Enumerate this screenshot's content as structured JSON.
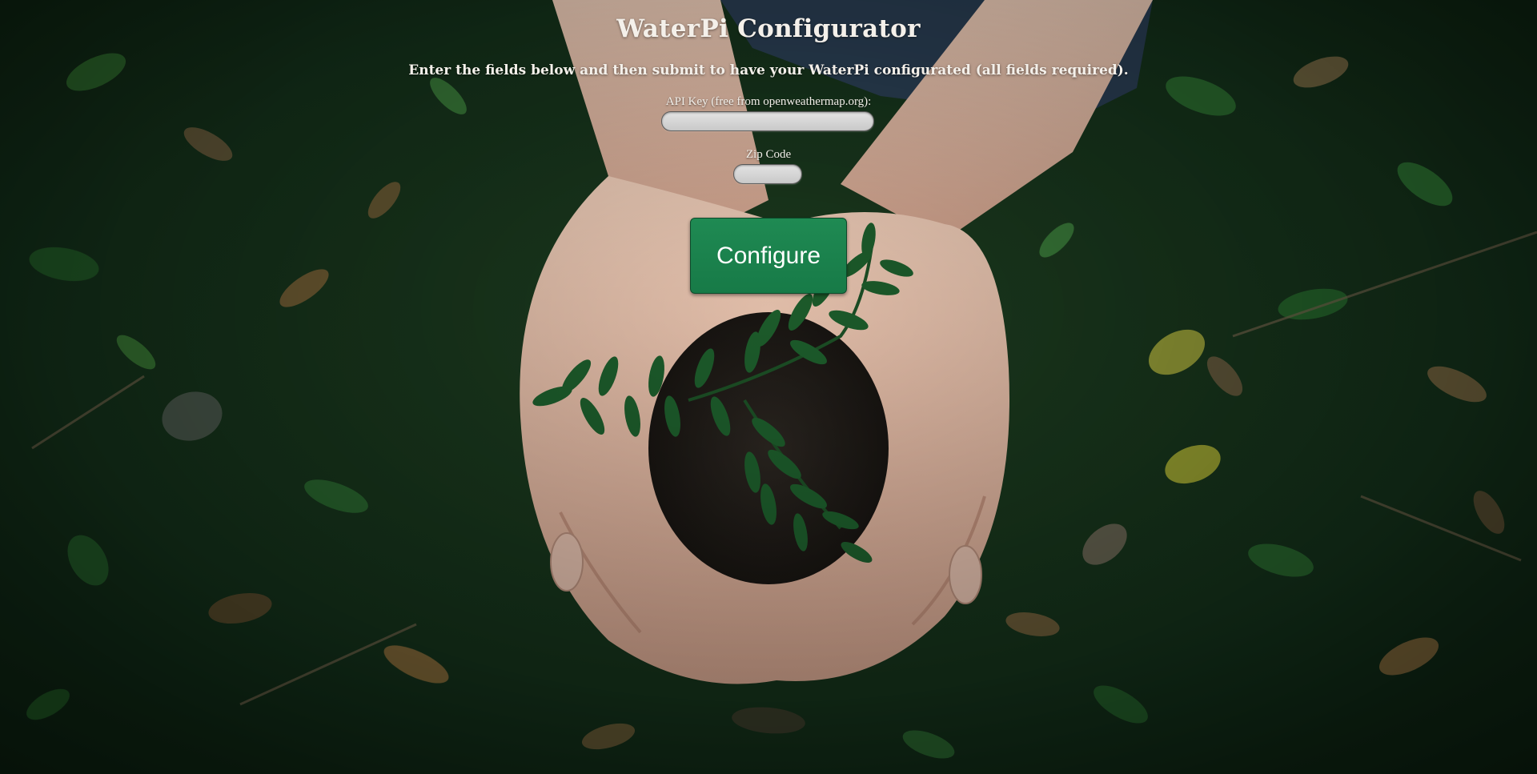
{
  "page": {
    "title": "WaterPi Configurator",
    "subtitle": "Enter the fields below and then submit to have your WaterPi configurated (all fields required)."
  },
  "form": {
    "api_key": {
      "label": "API Key (free from openweathermap.org):",
      "value": ""
    },
    "zip_code": {
      "label": "Zip Code",
      "value": ""
    },
    "submit_label": "Configure"
  },
  "colors": {
    "button_background": "#1f8a53",
    "button_text": "#ffffff",
    "heading_text": "#f4f0ea",
    "input_background": "#d6d6d6"
  },
  "background_image": {
    "description_icon": "hands-holding-seedling-photo"
  }
}
